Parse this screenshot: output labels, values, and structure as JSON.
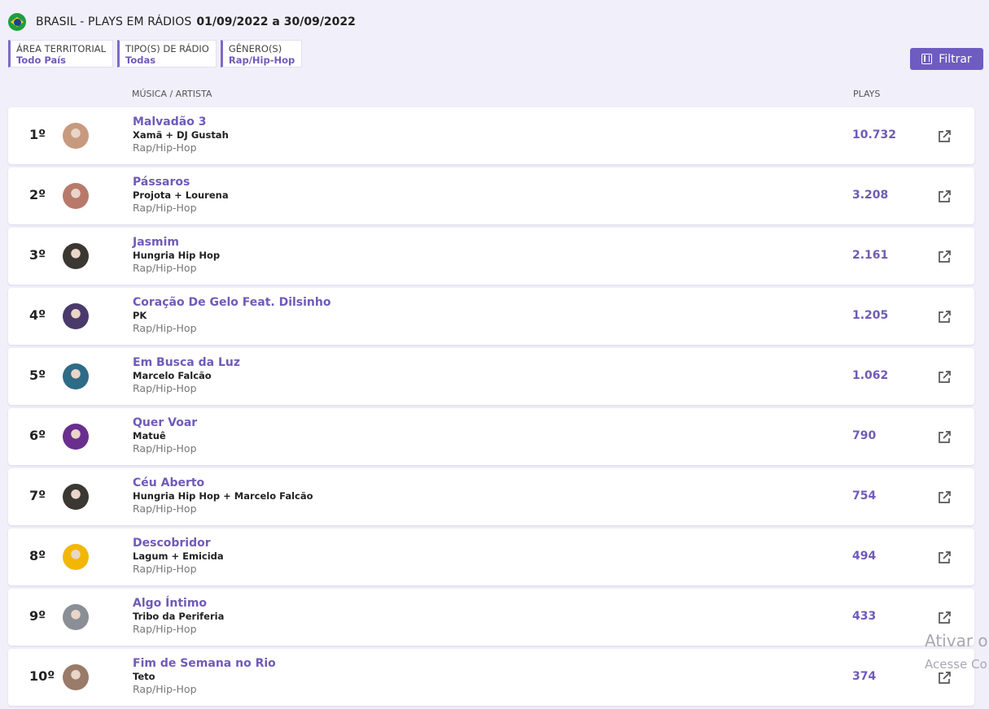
{
  "header": {
    "flag_icon": "brazil-flag-icon",
    "title": "BRASIL - PLAYS EM RÁDIOS",
    "date_range": "01/09/2022 a 30/09/2022"
  },
  "filters": [
    {
      "label": "ÁREA TERRITORIAL",
      "value": "Todo País"
    },
    {
      "label": "TIPO(S) DE RÁDIO",
      "value": "Todas"
    },
    {
      "label": "GÊNERO(S)",
      "value": "Rap/Hip-Hop"
    }
  ],
  "filter_button": {
    "label": "Filtrar",
    "icon": "sliders-icon"
  },
  "columns": {
    "song_artist": "MÚSICA / ARTISTA",
    "plays": "PLAYS"
  },
  "rows": [
    {
      "rank": "1º",
      "song": "Malvadão 3",
      "artist": "Xamã + DJ Gustah",
      "genre": "Rap/Hip-Hop",
      "plays": "10.732",
      "avatar_color": "#c79a7f"
    },
    {
      "rank": "2º",
      "song": "Pássaros",
      "artist": "Projota + Lourena",
      "genre": "Rap/Hip-Hop",
      "plays": "3.208",
      "avatar_color": "#b8796b"
    },
    {
      "rank": "3º",
      "song": "Jasmim",
      "artist": "Hungria Hip Hop",
      "genre": "Rap/Hip-Hop",
      "plays": "2.161",
      "avatar_color": "#3b3833"
    },
    {
      "rank": "4º",
      "song": "Coração De Gelo Feat. Dilsinho",
      "artist": "PK",
      "genre": "Rap/Hip-Hop",
      "plays": "1.205",
      "avatar_color": "#4a3a6b"
    },
    {
      "rank": "5º",
      "song": "Em Busca da Luz",
      "artist": "Marcelo Falcão",
      "genre": "Rap/Hip-Hop",
      "plays": "1.062",
      "avatar_color": "#2e6b86"
    },
    {
      "rank": "6º",
      "song": "Quer Voar",
      "artist": "Matuê",
      "genre": "Rap/Hip-Hop",
      "plays": "790",
      "avatar_color": "#6a2e8f"
    },
    {
      "rank": "7º",
      "song": "Céu Aberto",
      "artist": "Hungria Hip Hop + Marcelo Falcão",
      "genre": "Rap/Hip-Hop",
      "plays": "754",
      "avatar_color": "#3b3833"
    },
    {
      "rank": "8º",
      "song": "Descobridor",
      "artist": "Lagum + Emicida",
      "genre": "Rap/Hip-Hop",
      "plays": "494",
      "avatar_color": "#f2b705"
    },
    {
      "rank": "9º",
      "song": "Algo Íntimo",
      "artist": "Tribo da Periferia",
      "genre": "Rap/Hip-Hop",
      "plays": "433",
      "avatar_color": "#8a8f96"
    },
    {
      "rank": "10º",
      "song": "Fim de Semana no Rio",
      "artist": "Teto",
      "genre": "Rap/Hip-Hop",
      "plays": "374",
      "avatar_color": "#9a7a68"
    }
  ],
  "row_icon": "external-link-icon",
  "watermark": {
    "line1": "Ativar o",
    "line2": "Acesse Co"
  }
}
